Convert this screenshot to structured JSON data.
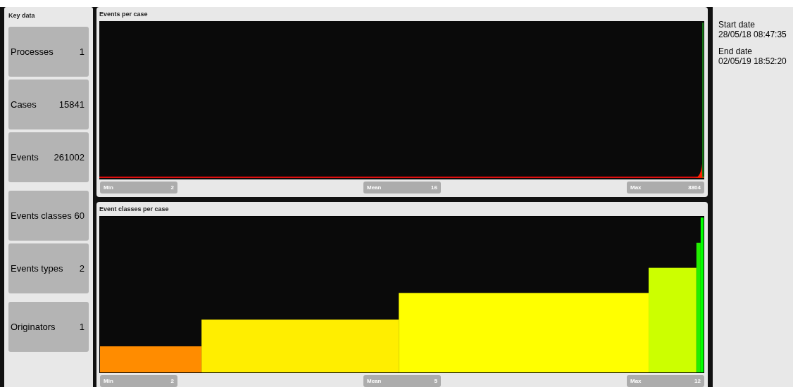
{
  "key_data": {
    "title": "Key data",
    "tiles": [
      {
        "label": "Processes",
        "value": "1"
      },
      {
        "label": "Cases",
        "value": "15841"
      },
      {
        "label": "Events",
        "value": "261002"
      },
      {
        "label": "Events classes",
        "value": "60"
      },
      {
        "label": "Events types",
        "value": "2"
      },
      {
        "label": "Originators",
        "value": "1"
      }
    ]
  },
  "panels": [
    {
      "title": "Events per case",
      "kind": "spike",
      "stats": [
        {
          "label": "Min",
          "value": "2"
        },
        {
          "label": "Mean",
          "value": "16"
        },
        {
          "label": "Max",
          "value": "8804"
        }
      ]
    },
    {
      "title": "Event classes per case",
      "kind": "steps",
      "stats": [
        {
          "label": "Min",
          "value": "2"
        },
        {
          "label": "Mean",
          "value": "5"
        },
        {
          "label": "Max",
          "value": "12"
        }
      ]
    }
  ],
  "dates": [
    {
      "label": "Start date",
      "value": "28/05/18 08:47:35"
    },
    {
      "label": "End date",
      "value": "02/05/19 18:52:20"
    }
  ]
}
